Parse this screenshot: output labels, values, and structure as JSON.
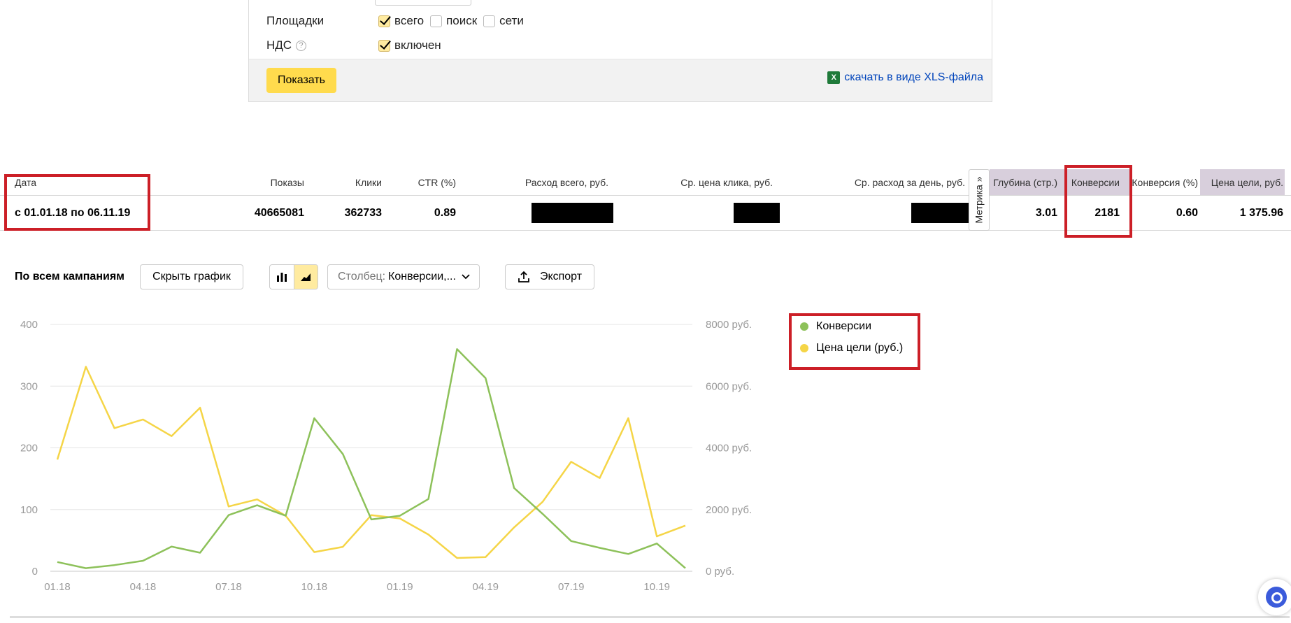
{
  "filters": {
    "platforms_label": "Площадки",
    "platforms": [
      {
        "label": "всего",
        "checked": true
      },
      {
        "label": "поиск",
        "checked": false
      },
      {
        "label": "сети",
        "checked": false
      }
    ],
    "vat_label": "НДС",
    "vat_help_icon": "question-circle-icon",
    "vat_option": {
      "label": "включен",
      "checked": true
    },
    "show_button": "Показать",
    "xls_link": "скачать в виде XLS-файла"
  },
  "stats": {
    "headers": {
      "date": "Дата",
      "impressions": "Показы",
      "clicks": "Клики",
      "ctr": "CTR (%)",
      "spend_total": "Расход всего, руб.",
      "avg_cpc": "Ср. цена клика, руб.",
      "avg_daily_spend": "Ср. расход за день, руб.",
      "depth": "Глубина (стр.)",
      "conversions": "Конверсии",
      "conversion_rate": "Конверсия (%)",
      "goal_cost": "Цена цели, руб."
    },
    "values": {
      "date": "с 01.01.18 по 06.11.19",
      "impressions": "40665081",
      "clicks": "362733",
      "ctr": "0.89",
      "depth": "3.01",
      "conversions": "2181",
      "conversion_rate": "0.60",
      "goal_cost": "1 375.96"
    },
    "metrika_tab": "Метрика »"
  },
  "toolbar": {
    "title": "По всем кампаниям",
    "hide_chart": "Скрыть график",
    "column_select_label": "Столбец:",
    "column_select_value": "Конверсии,...",
    "export": "Экспорт"
  },
  "colors": {
    "conversions": "#8dc15a",
    "goal_cost": "#f5d547",
    "accent_yellow": "#ffdb4d",
    "highlight_red": "#cc1f27"
  },
  "chart_data": {
    "type": "line",
    "x": [
      "01.18",
      "02.18",
      "03.18",
      "04.18",
      "05.18",
      "06.18",
      "07.18",
      "08.18",
      "09.18",
      "10.18",
      "11.18",
      "12.18",
      "01.19",
      "02.19",
      "03.19",
      "04.19",
      "05.19",
      "06.19",
      "07.19",
      "08.19",
      "09.19",
      "10.19",
      "11.19"
    ],
    "x_tick_labels": [
      "01.18",
      "04.18",
      "07.18",
      "10.18",
      "01.19",
      "04.19",
      "07.19",
      "10.19"
    ],
    "series": [
      {
        "name": "Конверсии",
        "axis": "left",
        "values": [
          15,
          5,
          10,
          17,
          40,
          30,
          91,
          107,
          90,
          248,
          190,
          84,
          90,
          117,
          360,
          313,
          135,
          93,
          49,
          38,
          28,
          45,
          5
        ]
      },
      {
        "name": "Цена цели (руб.)",
        "axis": "right",
        "values": [
          3620,
          6630,
          4640,
          4920,
          4380,
          5300,
          2100,
          2330,
          1800,
          620,
          790,
          1820,
          1710,
          1190,
          430,
          460,
          1420,
          2250,
          3550,
          3020,
          4960,
          1130,
          1480
        ]
      }
    ],
    "y_left": {
      "ticks": [
        "0",
        "100",
        "200",
        "300",
        "400"
      ],
      "ylim": [
        0,
        400
      ]
    },
    "y_right": {
      "ticks": [
        "0 руб.",
        "2000 руб.",
        "4000 руб.",
        "6000 руб.",
        "8000 руб."
      ],
      "ylim": [
        0,
        8000
      ]
    },
    "grid": true,
    "legend_position": "right"
  }
}
